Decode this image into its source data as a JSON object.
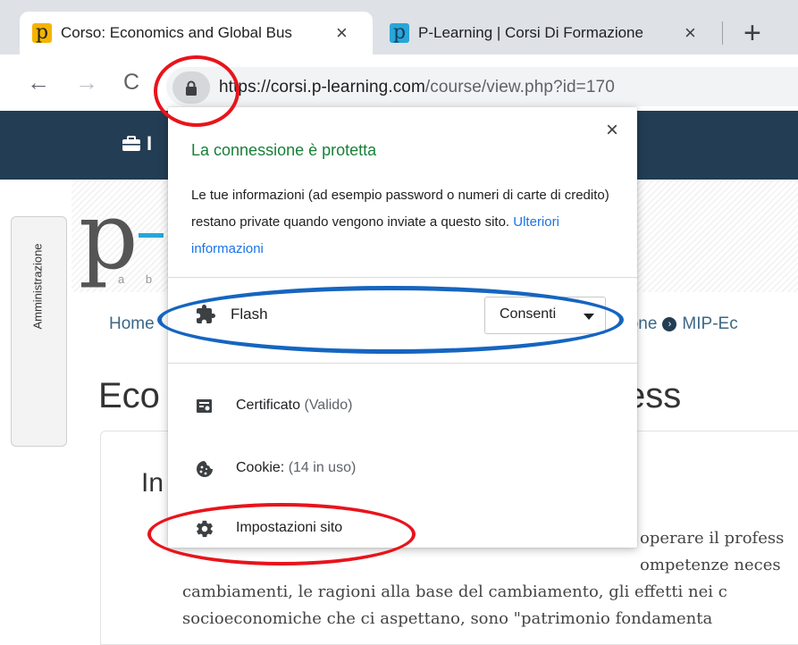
{
  "browser": {
    "tabs": [
      {
        "favicon": "p",
        "title": "Corso: Economics and Global Bus",
        "close": "×",
        "active": true
      },
      {
        "favicon": "p",
        "title": "P-Learning | Corsi Di Formazione",
        "close": "×",
        "active": false
      }
    ],
    "new_tab": "+",
    "url_host": "https://corsi.p-learning.com",
    "url_path": "/course/view.php?id=170"
  },
  "page": {
    "nav_item": "I",
    "logo_letter": "p",
    "logo_tagline": "a b i",
    "admin_label": "Amministrazione",
    "breadcrumb_home": "Home",
    "breadcrumb_visible": "zione",
    "breadcrumb_next": "MIP-Ec",
    "course_title_left": "Eco",
    "course_title_right": "ess",
    "section_heading": "In",
    "paragraph_lines": [
      "operare il profess",
      "ompetenze neces",
      "cambiamenti, le ragioni alla base del cambiamento, gli effetti nei c",
      "socioeconomiche che ci aspettano, sono \"patrimonio fondamenta"
    ]
  },
  "popup": {
    "close": "×",
    "title": "La connessione è protetta",
    "description": "Le tue informazioni (ad esempio password o numeri di carte di credito) restano private quando vengono inviate a questo sito.",
    "link": "Ulteriori informazioni",
    "flash": {
      "label": "Flash",
      "value": "Consenti"
    },
    "menu": [
      {
        "label": "Certificato",
        "sub": "(Valido)",
        "icon": "certificate-icon"
      },
      {
        "label": "Cookie:",
        "sub": "(14 in uso)",
        "icon": "cookie-icon"
      },
      {
        "label": "Impostazioni sito",
        "sub": "",
        "icon": "gear-icon"
      }
    ]
  },
  "colors": {
    "navbar": "#233d54",
    "secure_green": "#188038",
    "link_blue": "#1a73e8",
    "annotation_red": "#e8141b",
    "annotation_blue": "#1565c0"
  }
}
